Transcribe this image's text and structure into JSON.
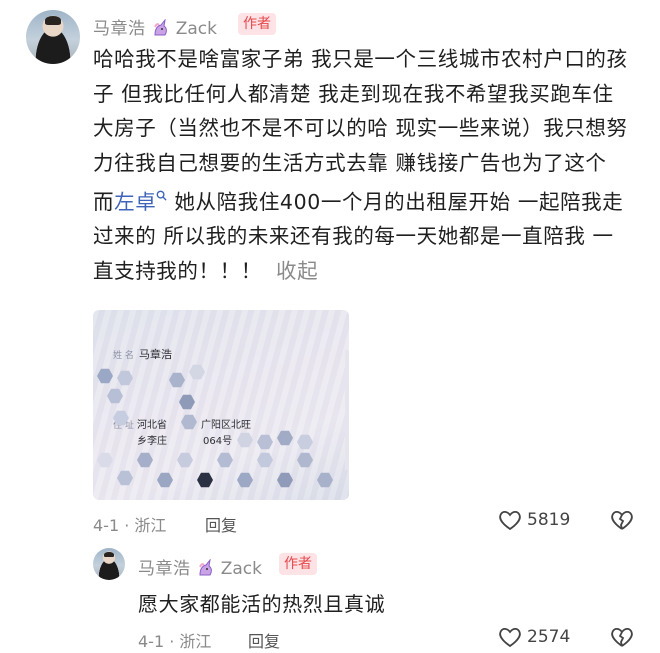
{
  "comment": {
    "username": "马章浩",
    "handle": "Zack",
    "badge": "作者",
    "text_before_link": "哈哈我不是啥富家子弟 我只是一个三线城市农村户口的孩子 但我比任何人都清楚 我走到现在我不希望我买跑车住大房子（当然也不是不可以的哈 现实一些来说）我只想努力往我自己想要的生活方式去靠 赚钱接广告也为了这个 而",
    "link_word": "左卓",
    "text_after_link": " 她从陪我住400一个月的出租屋开始 一起陪我走过来的 所以我的未来还有我的每一天她都是一直陪我 一直支持我的！！！",
    "collapse_label": "收起",
    "date": "4-1",
    "location": "浙江",
    "reply_label": "回复",
    "like_count": "5819",
    "icons": [
      "heart-outline-icon",
      "broken-heart-icon",
      "search-icon",
      "unicorn-icon"
    ]
  },
  "id_card": {
    "name_label": "姓 名",
    "name_value": "马章浩",
    "address_label": "住 址",
    "address_line1_left": "河北省",
    "address_line1_right": "广阳区北旺",
    "address_line2_left": "乡李庄",
    "address_line2_right": "064号"
  },
  "reply": {
    "username": "马章浩",
    "handle": "Zack",
    "badge": "作者",
    "text": "愿大家都能活的热烈且真诚",
    "date": "4-1",
    "location": "浙江",
    "reply_label": "回复",
    "like_count": "2574"
  },
  "colors": {
    "badge_bg": "#fde3e5",
    "badge_text": "#e5484d",
    "link": "#3e63b8",
    "muted": "#8a8a8a"
  }
}
